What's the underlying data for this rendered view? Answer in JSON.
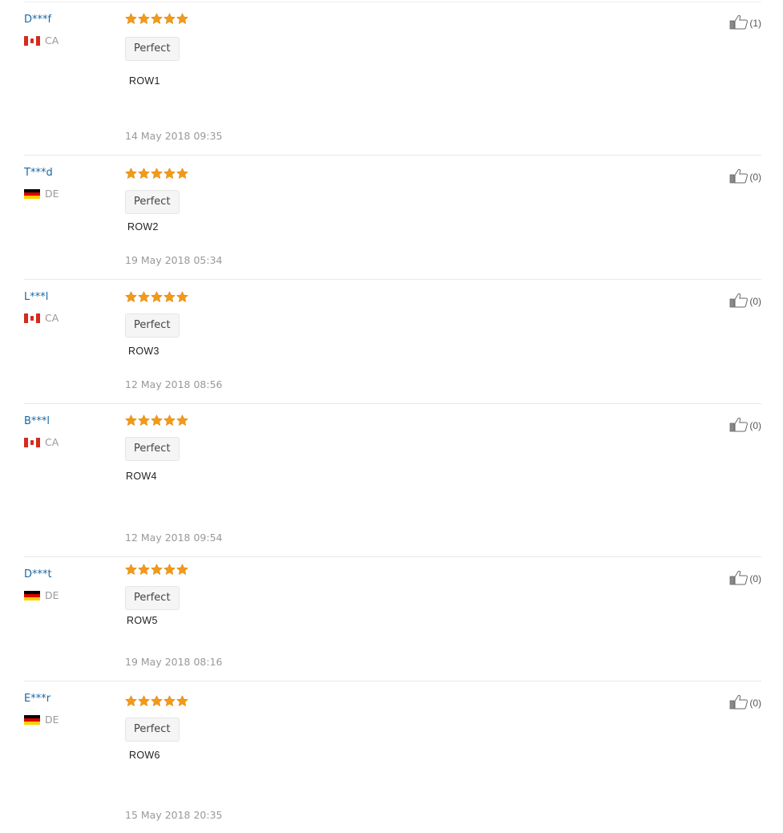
{
  "colors": {
    "username": "#1a67a3",
    "star": "#f29a18",
    "muted": "#999999"
  },
  "reviews": [
    {
      "user": "D***f",
      "country": "CA",
      "flag": "canada-flag-icon",
      "rating": 5,
      "tag": "Perfect",
      "text": "ROW1",
      "date": "14 May 2018 09:35",
      "helpful": "(1)"
    },
    {
      "user": "T***d",
      "country": "DE",
      "flag": "germany-flag-icon",
      "rating": 5,
      "tag": "Perfect",
      "text": "ROW2",
      "date": "19 May 2018 05:34",
      "helpful": "(0)"
    },
    {
      "user": "L***l",
      "country": "CA",
      "flag": "canada-flag-icon",
      "rating": 5,
      "tag": "Perfect",
      "text": "ROW3",
      "date": "12 May 2018 08:56",
      "helpful": "(0)"
    },
    {
      "user": "B***l",
      "country": "CA",
      "flag": "canada-flag-icon",
      "rating": 5,
      "tag": "Perfect",
      "text": "ROW4",
      "date": "12 May 2018 09:54",
      "helpful": "(0)"
    },
    {
      "user": "D***t",
      "country": "DE",
      "flag": "germany-flag-icon",
      "rating": 5,
      "tag": "Perfect",
      "text": "ROW5",
      "date": "19 May 2018 08:16",
      "helpful": "(0)"
    },
    {
      "user": "E***r",
      "country": "DE",
      "flag": "germany-flag-icon",
      "rating": 5,
      "tag": "Perfect",
      "text": "ROW6",
      "date": "15 May 2018 20:35",
      "helpful": "(0)"
    }
  ]
}
